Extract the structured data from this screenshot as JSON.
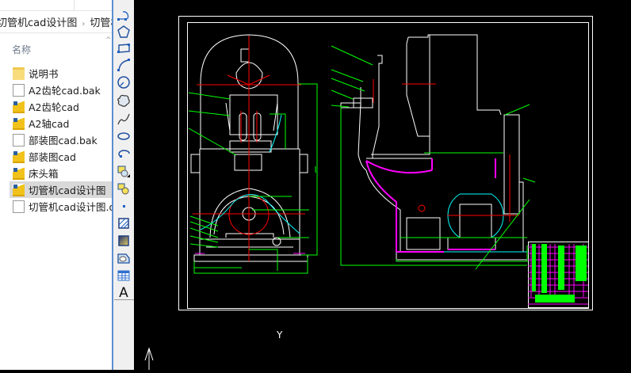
{
  "explorer": {
    "breadcrumb": [
      "切管机cad设计图",
      "切管机"
    ],
    "column_header": "名称",
    "files": [
      {
        "name": "说明书",
        "type": "folder"
      },
      {
        "name": "A2齿轮cad.bak",
        "type": "file"
      },
      {
        "name": "A2齿轮cad",
        "type": "dwg"
      },
      {
        "name": "A2轴cad",
        "type": "dwg"
      },
      {
        "name": "部装图cad.bak",
        "type": "file"
      },
      {
        "name": "部装图cad",
        "type": "dwg"
      },
      {
        "name": "床头箱",
        "type": "dwg"
      },
      {
        "name": "切管机cad设计图",
        "type": "dwg",
        "selected": true
      },
      {
        "name": "切管机cad设计图.dwl",
        "type": "file"
      }
    ]
  },
  "toolbar": {
    "tools": [
      "polyline-icon",
      "polygon-icon",
      "rectangle-icon",
      "arc-icon",
      "circle-icon",
      "revcloud-icon",
      "spline-icon",
      "ellipse-icon",
      "ellipse-arc-icon",
      "insert-block-icon",
      "make-block-icon",
      "point-icon",
      "hatch-icon",
      "gradient-icon",
      "region-icon",
      "table-icon",
      "multiline-text-icon"
    ],
    "text_tool_label": "A"
  },
  "canvas": {
    "ucs_label": "Y",
    "colors": {
      "background": "#000000",
      "lines": "#ffffff",
      "center": "#ff0000",
      "dimension": "#00ff00",
      "hidden": "#00ffff",
      "hatch": "#ff00ff"
    }
  }
}
